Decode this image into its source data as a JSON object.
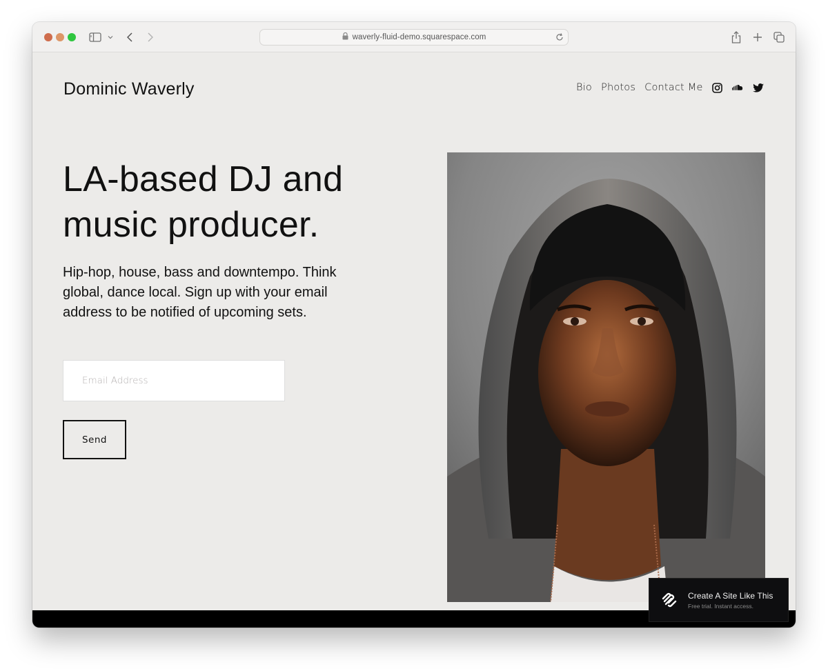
{
  "browser": {
    "url": "waverly-fluid-demo.squarespace.com",
    "icons": [
      "close-dot",
      "minimize-dot",
      "zoom-dot",
      "sidebar-toggle-icon",
      "chevron-down-icon",
      "back-arrow-icon",
      "forward-arrow-icon",
      "lock-icon",
      "reload-icon",
      "share-icon",
      "plus-icon",
      "tabs-overview-icon"
    ]
  },
  "site": {
    "title": "Dominic Waverly",
    "nav": [
      {
        "label": "Bio"
      },
      {
        "label": "Photos"
      },
      {
        "label": "Contact Me"
      }
    ],
    "social": [
      "instagram-icon",
      "soundcloud-icon",
      "twitter-icon"
    ]
  },
  "hero": {
    "headline": "LA-based DJ and music producer.",
    "intro": "Hip-hop, house, bass and downtempo. Think global, dance local. Sign up with your email address to be notified of upcoming sets.",
    "email_placeholder": "Email Address",
    "email_value": "",
    "send_label": "Send",
    "image_alt": "Portrait of a man wearing a black beanie and grey hooded sweatshirt"
  },
  "promo": {
    "title": "Create A Site Like This",
    "subtitle": "Free trial. Instant access.",
    "icon": "squarespace-logo-icon"
  },
  "colors": {
    "page_background": "#ecebe9",
    "text": "#111111",
    "footer": "#000000",
    "promo_background": "#0e0e10"
  }
}
